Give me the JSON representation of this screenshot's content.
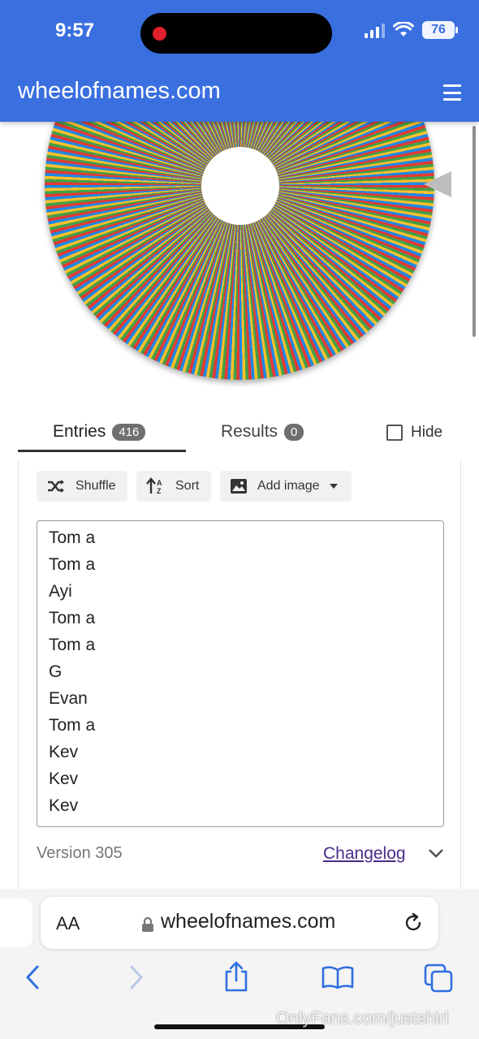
{
  "status_bar": {
    "time": "9:57",
    "battery": "76"
  },
  "header": {
    "site_title": "wheelofnames.com"
  },
  "tabs": {
    "entries_label": "Entries",
    "entries_count": "416",
    "results_label": "Results",
    "results_count": "0",
    "hide_label": "Hide"
  },
  "toolbar": {
    "shuffle_label": "Shuffle",
    "sort_label": "Sort",
    "add_image_label": "Add image"
  },
  "entries": [
    "Tom a",
    "Tom a",
    "Ayi",
    "Tom a",
    "Tom a",
    "G",
    "Evan",
    "Tom a",
    "Kev",
    "Kev",
    "Kev"
  ],
  "footer": {
    "version": "Version 305",
    "changelog": "Changelog"
  },
  "browser": {
    "text_size_label": "AA",
    "url": "wheelofnames.com"
  },
  "watermark": "OnlyFans.com/justshirl",
  "colors": {
    "app_bar": "#3a6fe0",
    "wheel": [
      "#e53935",
      "#43a047",
      "#fbc02d",
      "#1e88e5"
    ]
  }
}
